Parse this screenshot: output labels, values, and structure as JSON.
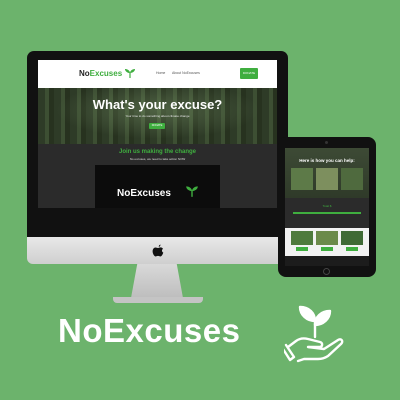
{
  "colors": {
    "background": "#6cb36c",
    "accent": "#3fae3f"
  },
  "brand": {
    "name": "NoExcuses",
    "icon": "hand-sprout-icon"
  },
  "desktop_site": {
    "nav": {
      "logo_prefix": "No",
      "logo_accent": "Excuses",
      "links": [
        "Home",
        "About NoExcuses"
      ],
      "cta": "DONATE NOW"
    },
    "hero": {
      "title": "What's your excuse?",
      "subtitle": "Your time to do something about climate change",
      "button": "DONATE"
    },
    "join": {
      "title": "Join us making the change",
      "subtitle": "No excuses, we need to take action NOW"
    },
    "video_logo": "NoExcuses"
  },
  "tablet_site": {
    "hero_title": "Here is how you can help:",
    "band_title": "Total $",
    "footer_logo": "NoExcuses"
  }
}
